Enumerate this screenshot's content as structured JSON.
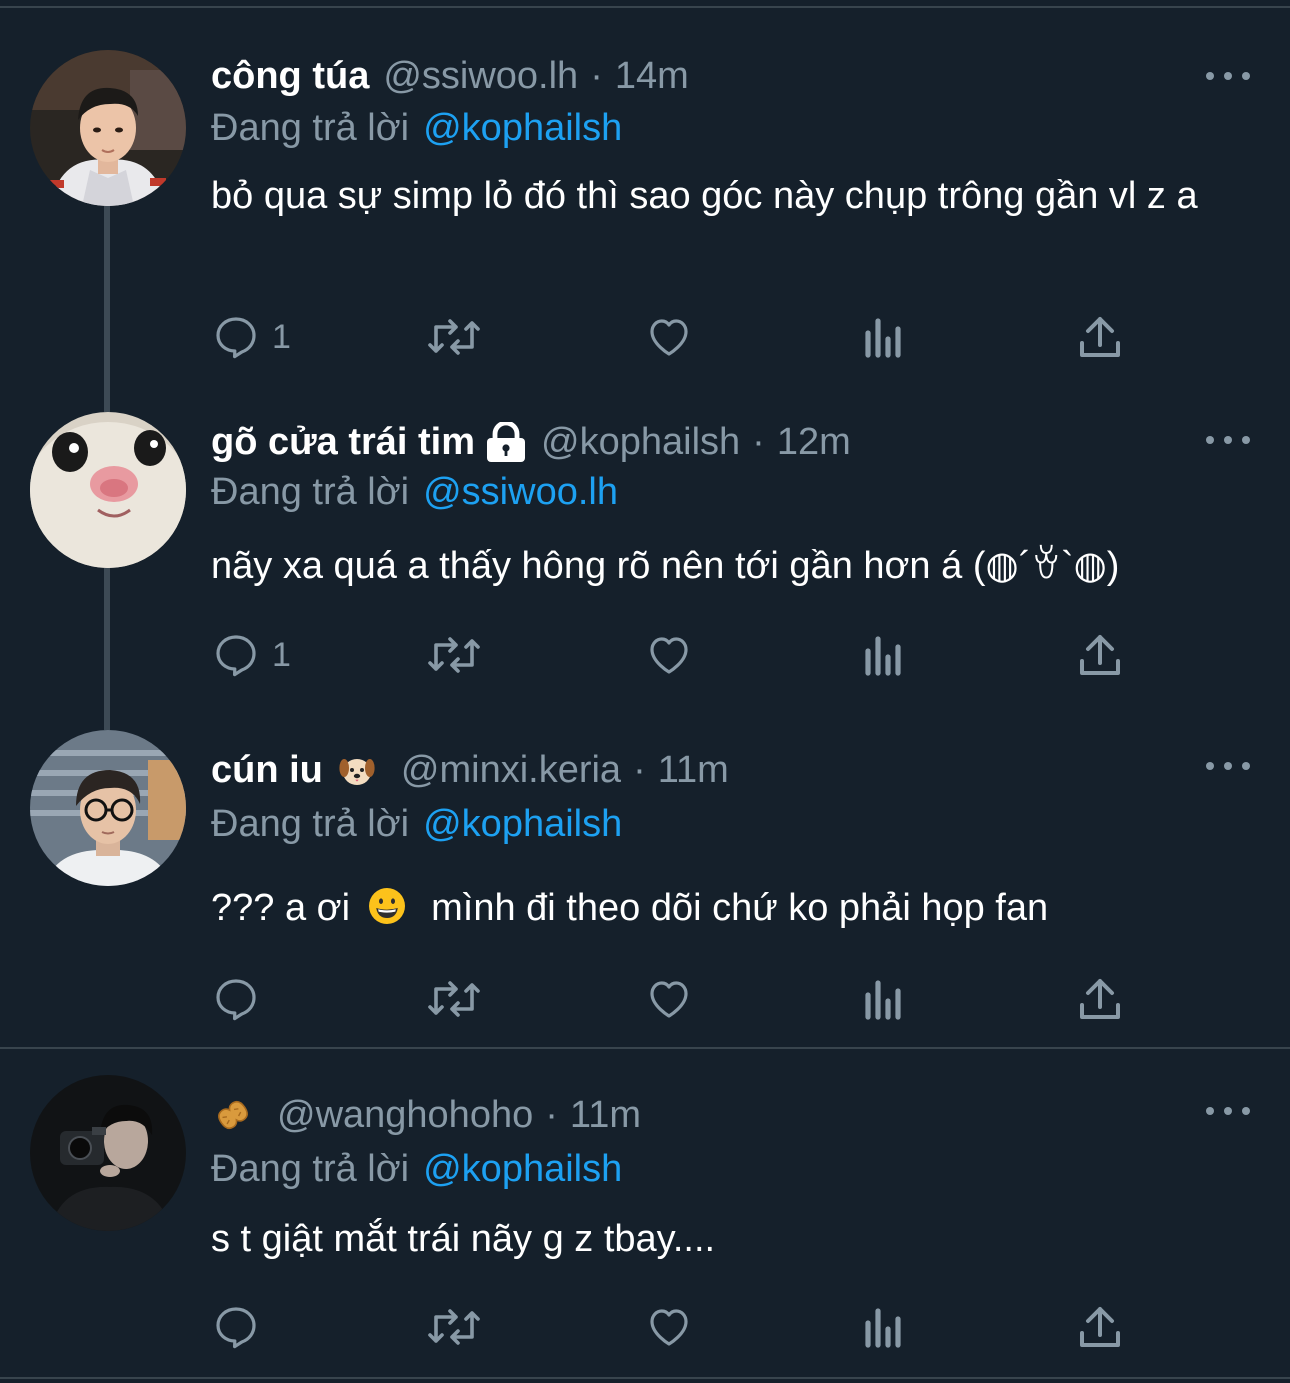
{
  "tweets": [
    {
      "name": "công túa",
      "handle": "@ssiwoo.lh",
      "time": "14m",
      "reply_prefix": "Đang trả lời",
      "reply_to": "@kophailsh",
      "text": "bỏ qua sự simp lỏ đó thì sao góc này chụp trông gần vl z a",
      "reply_count": "1",
      "avatar_icon": "avatar-photo"
    },
    {
      "name": "gõ cửa trái tim",
      "handle": "@kophailsh",
      "time": "12m",
      "reply_prefix": "Đang trả lời",
      "reply_to": "@ssiwoo.lh",
      "text": "nãy xa quá a thấy hông rõ nên tới gần hơn á (◍´ꈊ`◍)",
      "reply_count": "1",
      "name_icon": "lock-icon"
    },
    {
      "name": "cún iu",
      "handle": "@minxi.keria",
      "time": "11m",
      "reply_prefix": "Đang trả lời",
      "reply_to": "@kophailsh",
      "text_before": "??? a ơi",
      "text_after": "mình đi theo dõi chứ ko phải họp fan",
      "reply_count": "",
      "name_icon": "dog-emoji-icon",
      "text_icon": "grinning-emoji-icon"
    },
    {
      "name": "",
      "handle": "@wanghohoho",
      "time": "11m",
      "reply_prefix": "Đang trả lời",
      "reply_to": "@kophailsh",
      "text": "s t giật mắt trái nãy g z tbay....",
      "reply_count": "",
      "name_icon": "peanut-emoji-icon"
    }
  ],
  "separator_dot": "·",
  "colors": {
    "background": "#15202b",
    "primary_text": "#ffffff",
    "secondary_text": "#8899a6",
    "accent": "#1da1f2",
    "divider": "#38444d"
  }
}
